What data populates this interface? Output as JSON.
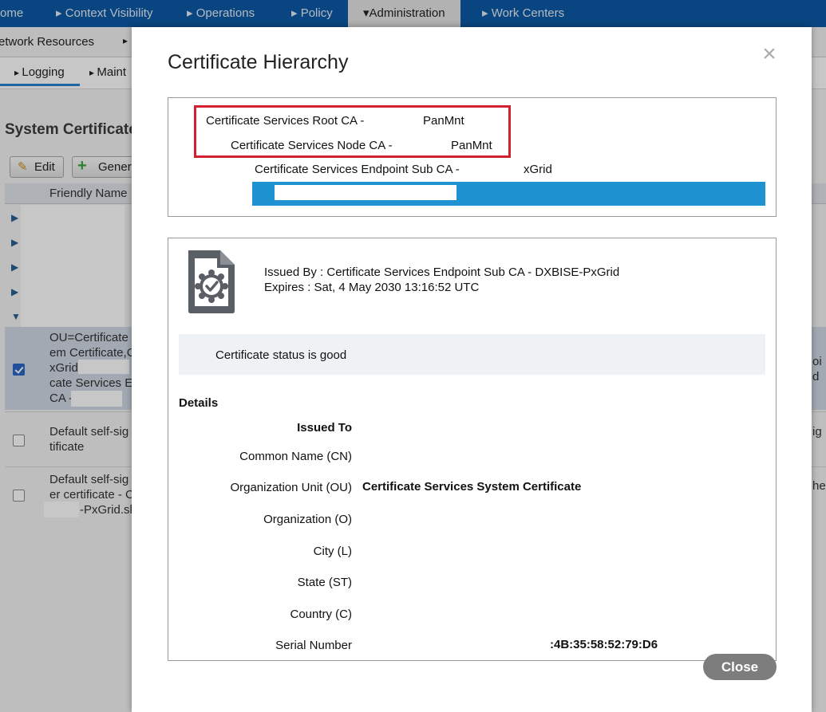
{
  "nav": {
    "home": "ome",
    "items": [
      "Context Visibility",
      "Operations",
      "Policy",
      "Administration",
      "Work Centers"
    ]
  },
  "subnav": {
    "network_resources": "etwork Resources",
    "logging": "Logging",
    "maintenance": "Maint"
  },
  "background": {
    "title": "System Certificate",
    "edit_button": "Edit",
    "generate_button": "Gener",
    "column_friendly_name": "Friendly Name",
    "rows": {
      "selected_lines": [
        "OU=Certificate",
        "em Certificate,C",
        "xGrid",
        "cate Services E",
        "CA -"
      ],
      "selected_right": [
        "oi",
        "d"
      ],
      "row2_lines": [
        "Default self-sig",
        "tificate"
      ],
      "row2_right": "ig",
      "row3_lines": [
        "Default self-sig",
        "er certificate - C",
        "-PxGrid.sh"
      ],
      "row3_right": "he"
    }
  },
  "modal": {
    "title": "Certificate Hierarchy",
    "close_x": "×",
    "hierarchy": {
      "root_label": "Certificate Services Root CA -",
      "root_value": "PanMnt",
      "node_label": "Certificate Services Node CA -",
      "node_value": "PanMnt",
      "endpoint_label": "Certificate Services Endpoint Sub CA -",
      "endpoint_value": "xGrid"
    },
    "issued_by": "Issued By : Certificate Services Endpoint Sub CA - DXBISE-PxGrid",
    "expires": "Expires : Sat, 4 May 2030 13:16:52 UTC",
    "status": "Certificate status is good",
    "details_heading": "Details",
    "fields": {
      "issued_to": "Issued To",
      "cn_label": "Common Name (CN)",
      "ou_label": "Organization Unit (OU)",
      "ou_value": "Certificate Services System Certificate",
      "o_label": "Organization (O)",
      "l_label": "City (L)",
      "st_label": "State (ST)",
      "c_label": "Country (C)",
      "serial_label": "Serial Number",
      "serial_value": ":4B:35:58:52:79:D6"
    },
    "close_button": "Close"
  }
}
